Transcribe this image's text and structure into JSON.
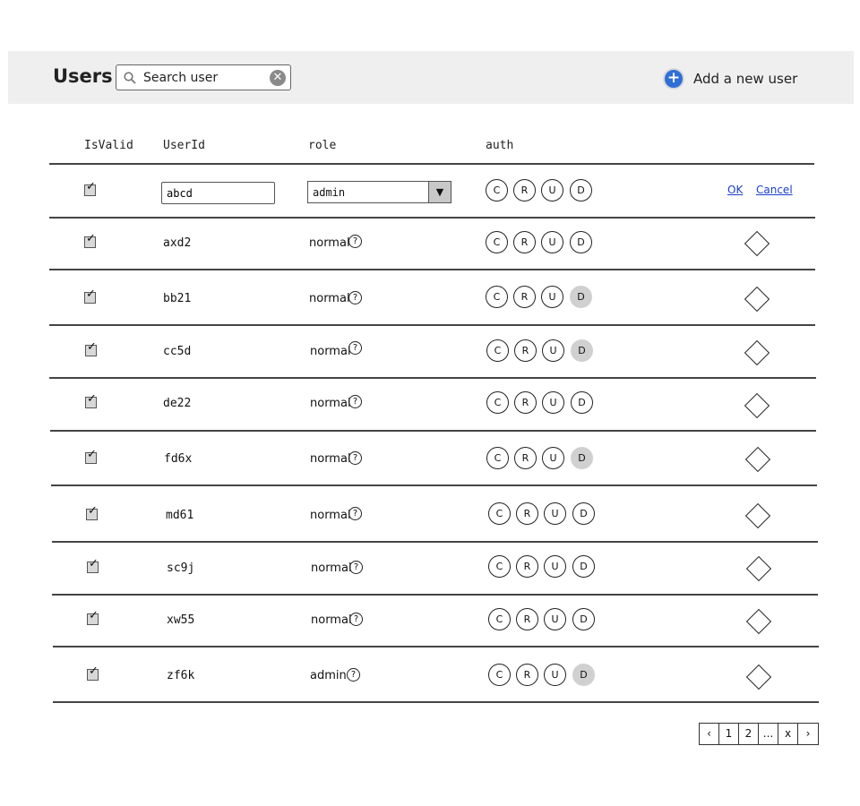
{
  "header": {
    "title": "Users",
    "search_placeholder": "Search user",
    "add_user_label": "Add a new user"
  },
  "columns": {
    "isvalid": "IsValid",
    "userid": "UserId",
    "role": "role",
    "auth": "auth"
  },
  "edit_row": {
    "userid": "abcd",
    "role": "admin",
    "ok": "OK",
    "cancel": "Cancel"
  },
  "auth_letters": [
    "C",
    "R",
    "U",
    "D"
  ],
  "rows": [
    {
      "userid": "axd2",
      "role": "normal",
      "delete_enabled": true
    },
    {
      "userid": "bb21",
      "role": "normal",
      "delete_enabled": false
    },
    {
      "userid": "cc5d",
      "role": "normal",
      "delete_enabled": false
    },
    {
      "userid": "de22",
      "role": "normal",
      "delete_enabled": true
    },
    {
      "userid": "fd6x",
      "role": "normal",
      "delete_enabled": false
    },
    {
      "userid": "md61",
      "role": "normal",
      "delete_enabled": true
    },
    {
      "userid": "sc9j",
      "role": "normal",
      "delete_enabled": true
    },
    {
      "userid": "xw55",
      "role": "normal",
      "delete_enabled": true
    },
    {
      "userid": "zf6k",
      "role": "admin",
      "delete_enabled": false
    }
  ],
  "pager": [
    "‹",
    "1",
    "2",
    "...",
    "x",
    "›"
  ],
  "icons": {
    "search": "magnifier-icon",
    "clear": "clear-icon",
    "add": "plus-icon",
    "help": "help-icon",
    "row_action": "diamond-icon",
    "dropdown": "dropdown-arrow-icon"
  },
  "colors": {
    "header_bg": "#efefef",
    "add_button": "#2f6fd6",
    "link": "#1a3fcf",
    "disabled_auth": "#d0d0d0"
  }
}
